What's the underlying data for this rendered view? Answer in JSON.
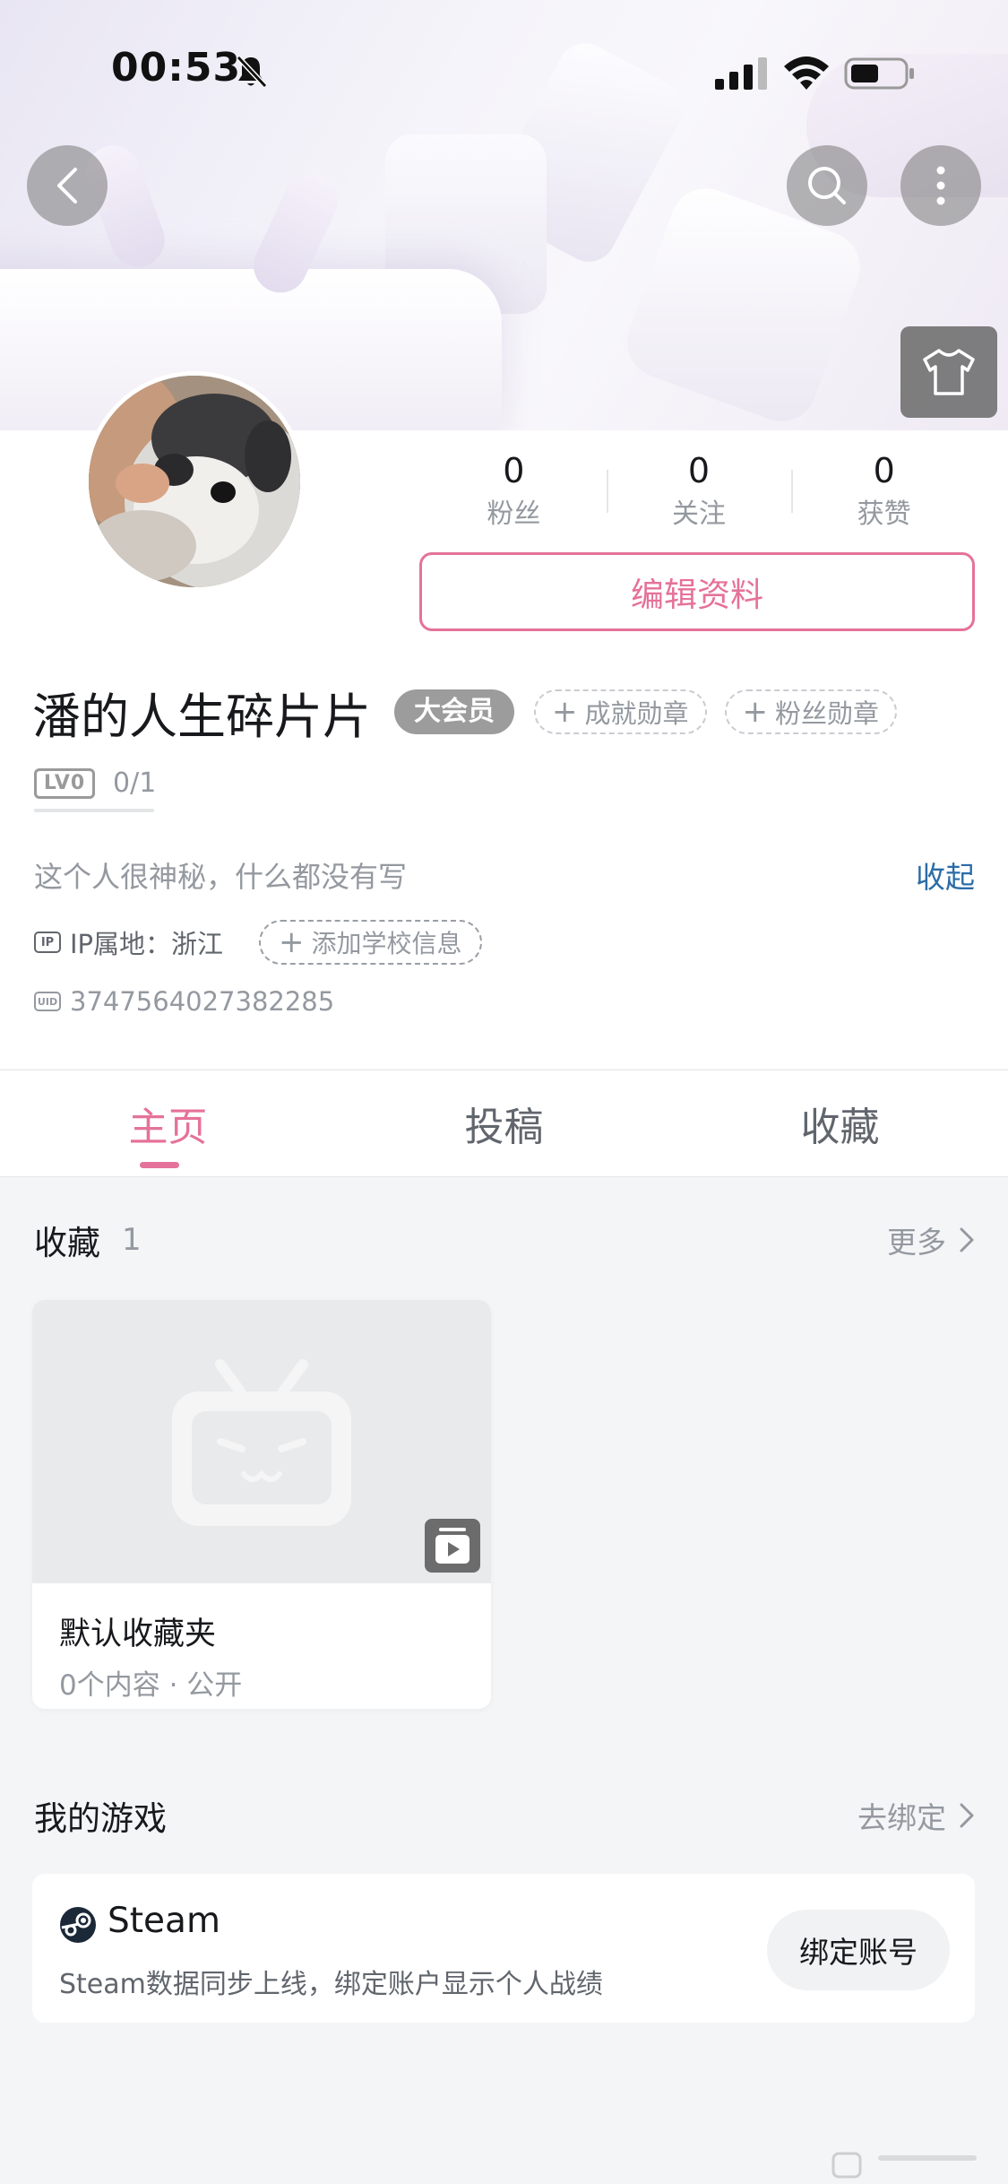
{
  "status_bar": {
    "time": "00:53",
    "icons": [
      "bell-slash-icon",
      "signal-icon",
      "wifi-icon",
      "battery-icon"
    ]
  },
  "header": {
    "buttons": [
      "back-icon",
      "search-icon",
      "more-icon",
      "outfit-icon"
    ]
  },
  "profile": {
    "stats": [
      {
        "value": "0",
        "label": "粉丝"
      },
      {
        "value": "0",
        "label": "关注"
      },
      {
        "value": "0",
        "label": "获赞"
      }
    ],
    "edit_label": "编辑资料",
    "username": "潘的人生碎片片",
    "vip_label": "大会员",
    "achievement_medal_label": "成就勋章",
    "fan_medal_label": "粉丝勋章",
    "level_badge": "LV0",
    "level_exp": "0/1",
    "bio": "这个人很神秘，什么都没有写",
    "collapse_label": "收起",
    "ip_tag": "IP",
    "ip_location": "IP属地：浙江",
    "add_school_label": "添加学校信息",
    "uid_tag": "UID",
    "uid": "3747564027382285"
  },
  "tabs": [
    {
      "label": "主页",
      "active": true
    },
    {
      "label": "投稿",
      "active": false
    },
    {
      "label": "收藏",
      "active": false
    }
  ],
  "favorites": {
    "title": "收藏",
    "count": "1",
    "more_label": "更多",
    "folder": {
      "name": "默认收藏夹",
      "meta": "0个内容 · 公开"
    }
  },
  "games": {
    "title": "我的游戏",
    "bind_link_label": "去绑定",
    "item": {
      "name": "Steam",
      "description": "Steam数据同步上线，绑定账户显示个人战绩",
      "bind_button_label": "绑定账号"
    }
  },
  "colors": {
    "accent_pink": "#e5729a",
    "link_blue": "#2a6ca8",
    "text_primary": "#18191c",
    "text_secondary": "#9499a0",
    "page_bg": "#f4f5f7"
  }
}
